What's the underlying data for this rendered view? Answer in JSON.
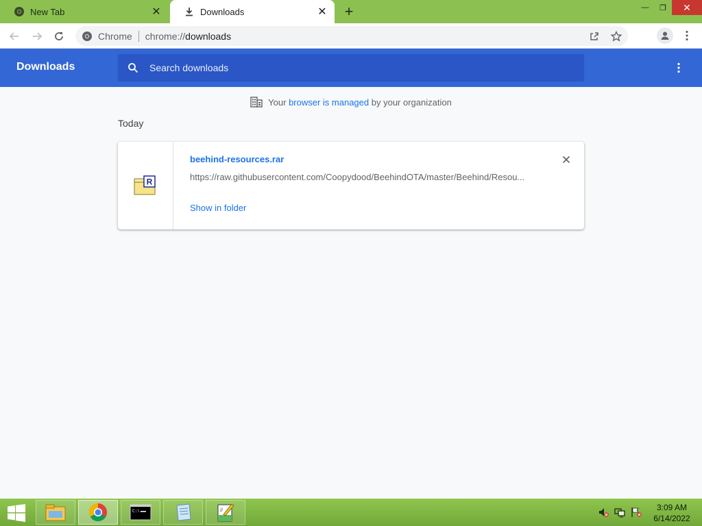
{
  "browser": {
    "tabs": [
      {
        "title": "New Tab",
        "active": false,
        "icon": "chrome-icon"
      },
      {
        "title": "Downloads",
        "active": true,
        "icon": "download-icon"
      }
    ],
    "new_tab_glyph": "+",
    "window_controls": {
      "minimize": "—",
      "restore": "❐",
      "close": "✕"
    },
    "omnibox": {
      "site_chip": "Chrome",
      "url_scheme": "chrome://",
      "url_host": "downloads"
    },
    "colors": {
      "frame": "#8cc152",
      "accent": "#3367d6",
      "link": "#1a73e8"
    }
  },
  "downloads_page": {
    "title": "Downloads",
    "search": {
      "placeholder": "Search downloads",
      "value": ""
    },
    "managed_notice": {
      "prefix": "Your",
      "link": "browser is managed",
      "suffix": "by your organization"
    },
    "groups": [
      {
        "date_label": "Today",
        "items": [
          {
            "file_name": "beehind-resources.rar",
            "url": "https://raw.githubusercontent.com/Coopydood/BeehindOTA/master/Beehind/Resou...",
            "action": "Show in folder",
            "icon": "rar-archive-icon"
          }
        ]
      }
    ]
  },
  "taskbar": {
    "items": [
      "file-explorer-icon",
      "chrome-icon",
      "command-prompt-icon",
      "notepad-icon",
      "editor-icon"
    ],
    "active_item": "chrome-icon",
    "clock": {
      "time": "3:09 AM",
      "date": "6/14/2022"
    }
  }
}
